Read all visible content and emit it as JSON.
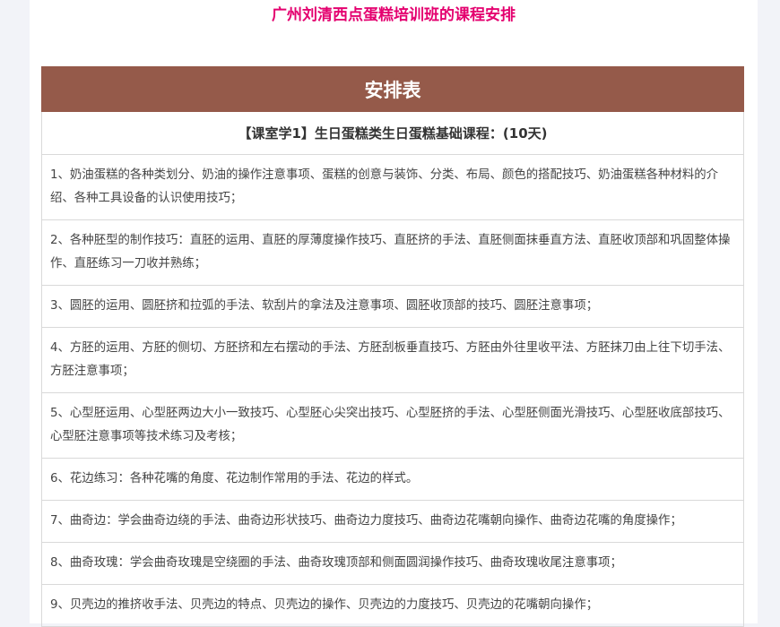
{
  "page": {
    "title": "广州刘清西点蛋糕培训班的课程安排"
  },
  "table": {
    "heading": "安排表",
    "section_title": "【课室学1】生日蛋糕类生日蛋糕基础课程：(10天)",
    "items": [
      "1、奶油蛋糕的各种类划分、奶油的操作注意事项、蛋糕的创意与装饰、分类、布局、颜色的搭配技巧、奶油蛋糕各种材料的介绍、各种工具设备的认识使用技巧；",
      "2、各种胚型的制作技巧：直胚的运用、直胚的厚薄度操作技巧、直胚挤的手法、直胚侧面抹垂直方法、直胚收顶部和巩固整体操作、直胚练习一刀收并熟练；",
      "3、圆胚的运用、圆胚挤和拉弧的手法、软刮片的拿法及注意事项、圆胚收顶部的技巧、圆胚注意事项；",
      "4、方胚的运用、方胚的侧切、方胚挤和左右摆动的手法、方胚刮板垂直技巧、方胚由外往里收平法、方胚抹刀由上往下切手法、方胚注意事项；",
      "5、心型胚运用、心型胚两边大小一致技巧、心型胚心尖突出技巧、心型胚挤的手法、心型胚侧面光滑技巧、心型胚收底部技巧、心型胚注意事项等技术练习及考核；",
      "6、花边练习：各种花嘴的角度、花边制作常用的手法、花边的样式。",
      "7、曲奇边：学会曲奇边绕的手法、曲奇边形状技巧、曲奇边力度技巧、曲奇边花嘴朝向操作、曲奇边花嘴的角度操作；",
      "8、曲奇玫瑰：学会曲奇玫瑰是空绕圈的手法、曲奇玫瑰顶部和侧面圆润操作技巧、曲奇玫瑰收尾注意事项；",
      "9、贝壳边的推挤收手法、贝壳边的特点、贝壳边的操作、贝壳边的力度技巧、贝壳边的花嘴朝向操作；"
    ]
  },
  "colors": {
    "title": "#e4006f",
    "header_bg": "#955a4a"
  }
}
